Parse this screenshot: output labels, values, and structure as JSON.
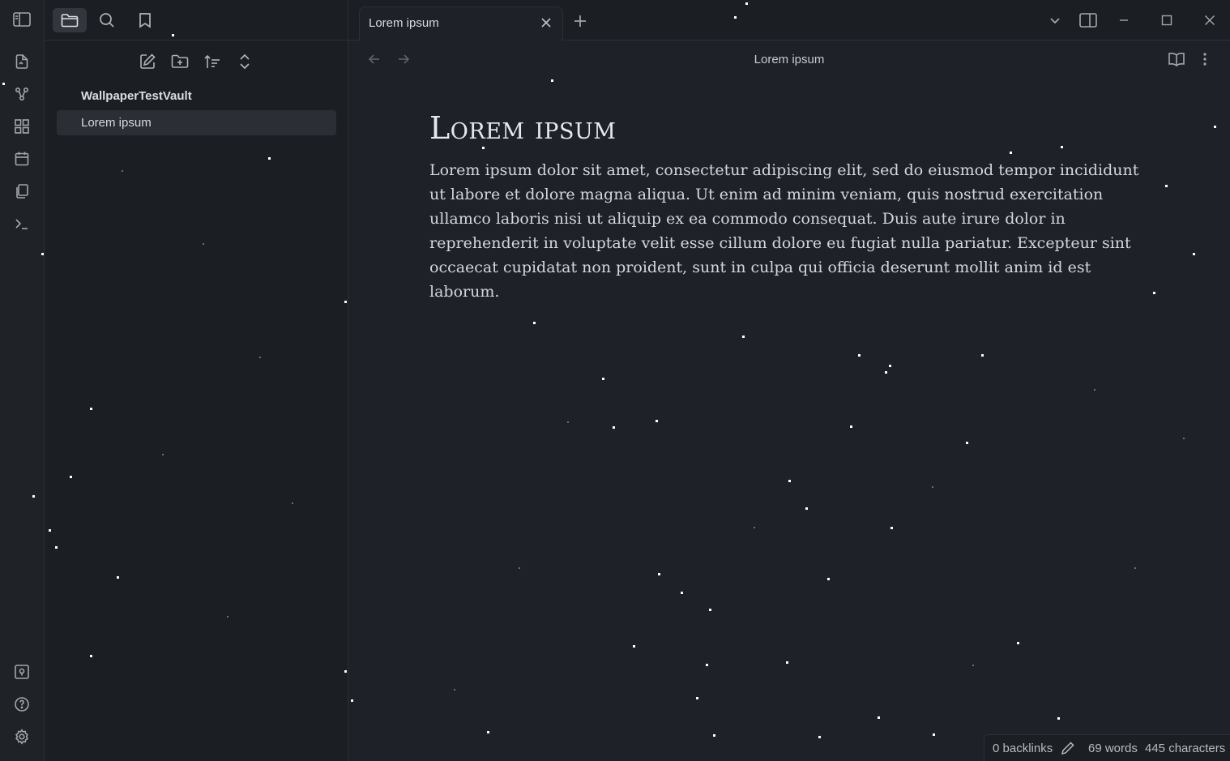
{
  "sidebar": {
    "vault_name": "WallpaperTestVault",
    "files": [
      {
        "name": "Lorem ipsum"
      }
    ]
  },
  "tabs": [
    {
      "label": "Lorem ipsum"
    }
  ],
  "note": {
    "header_title": "Lorem ipsum",
    "title": "Lorem ipsum",
    "body": "Lorem ipsum dolor sit amet, consectetur adipiscing elit, sed do eiusmod tempor incididunt ut labore et dolore magna aliqua. Ut enim ad minim veniam, quis nostrud exercitation ullamco laboris nisi ut aliquip ex ea commodo consequat. Duis aute irure dolor in reprehenderit in voluptate velit esse cillum dolore eu fugiat nulla pariatur. Excepteur sint occaecat cupidatat non proident, sunt in culpa qui officia deserunt mollit anim id est laborum."
  },
  "status_bar": {
    "backlinks": "0 backlinks",
    "words": "69 words",
    "characters": "445 characters"
  },
  "icons": {
    "ribbon_top": [
      "new-note-icon",
      "graph-icon",
      "canvas-icon",
      "calendar-icon",
      "templates-icon",
      "terminal-icon"
    ],
    "ribbon_bottom": [
      "vault-switcher-icon",
      "help-icon",
      "settings-icon"
    ],
    "sidebar_tabs": [
      "files-icon",
      "search-icon",
      "bookmarks-icon"
    ],
    "file_actions": [
      "new-note-icon",
      "new-folder-icon",
      "sort-icon",
      "collapse-icon"
    ]
  },
  "colors": {
    "background": "#1e2127",
    "sidebar": "#1b1e22",
    "border": "#2c2f36",
    "active_item": "#2b2e35",
    "text": "#d8dadf"
  }
}
